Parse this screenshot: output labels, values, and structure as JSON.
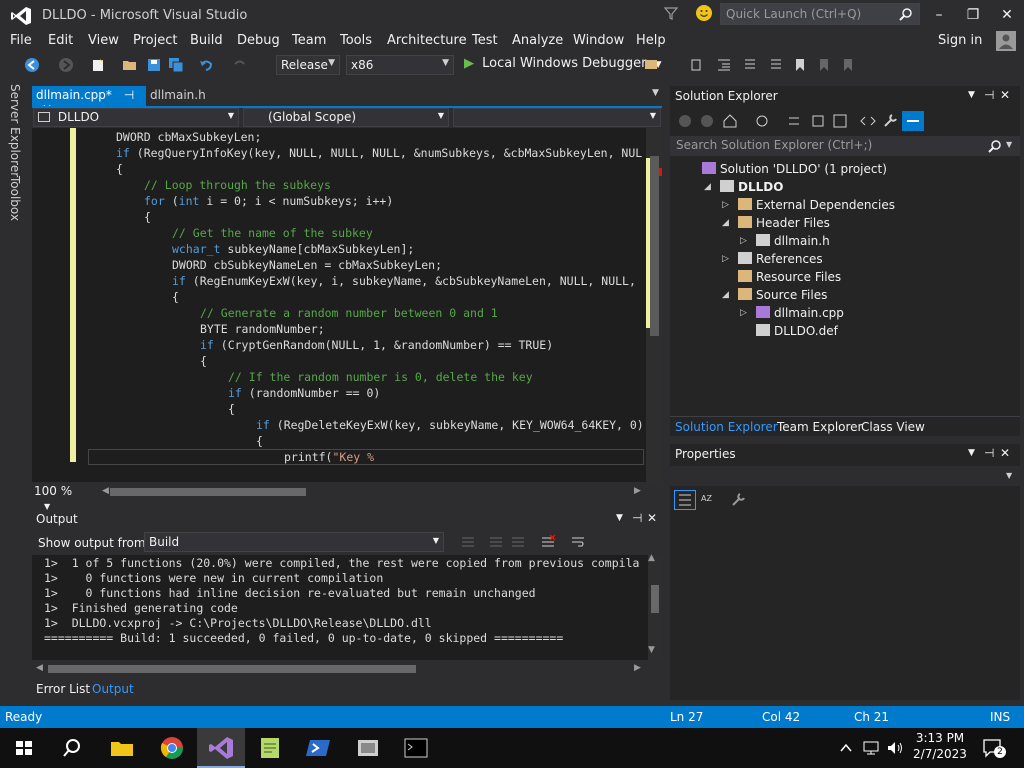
{
  "window": {
    "title": "DLLDO - Microsoft Visual Studio",
    "quick_launch_placeholder": "Quick Launch (Ctrl+Q)",
    "minimize": "–",
    "maximize": "❐",
    "close": "✕"
  },
  "menu": [
    "File",
    "Edit",
    "View",
    "Project",
    "Build",
    "Debug",
    "Team",
    "Tools",
    "Architecture",
    "Test",
    "Analyze",
    "Window",
    "Help"
  ],
  "account": {
    "sign_in": "Sign in"
  },
  "toolbar": {
    "configuration": "Release",
    "platform": "x86",
    "run_label": "Local Windows Debugger"
  },
  "left_strip": {
    "server_explorer": "Server Explorer",
    "toolbox": "Toolbox"
  },
  "editor": {
    "tabs": [
      {
        "label": "dllmain.cpp*",
        "pin": "⊣",
        "close": "✕"
      },
      {
        "label": "dllmain.h"
      }
    ],
    "nav_project": "DLLDO",
    "nav_scope": "(Global Scope)",
    "zoom": "100 %",
    "lines": [
      {
        "indent": 0,
        "parts": [
          {
            "t": "DWORD cbMaxSubkeyLen;",
            "c": ""
          }
        ]
      },
      {
        "indent": 0,
        "parts": [
          {
            "t": "if",
            "c": "kw"
          },
          {
            "t": " (RegQueryInfoKey(key, NULL, NULL, NULL, &numSubkeys, &cbMaxSubkeyLen, NUL",
            "c": ""
          }
        ]
      },
      {
        "indent": 0,
        "parts": [
          {
            "t": "{",
            "c": ""
          }
        ]
      },
      {
        "indent": 4,
        "parts": [
          {
            "t": "// Loop through the subkeys",
            "c": "cm"
          }
        ]
      },
      {
        "indent": 4,
        "parts": [
          {
            "t": "for",
            "c": "kw"
          },
          {
            "t": " (",
            "c": ""
          },
          {
            "t": "int",
            "c": "kw"
          },
          {
            "t": " i = 0; i < numSubkeys; i++)",
            "c": ""
          }
        ]
      },
      {
        "indent": 4,
        "parts": [
          {
            "t": "{",
            "c": ""
          }
        ]
      },
      {
        "indent": 8,
        "parts": [
          {
            "t": "// Get the name of the subkey",
            "c": "cm"
          }
        ]
      },
      {
        "indent": 8,
        "parts": [
          {
            "t": "wchar_t",
            "c": "kw"
          },
          {
            "t": " subkeyName[cbMaxSubkeyLen];",
            "c": ""
          }
        ]
      },
      {
        "indent": 8,
        "parts": [
          {
            "t": "DWORD cbSubkeyNameLen = cbMaxSubkeyLen;",
            "c": ""
          }
        ]
      },
      {
        "indent": 8,
        "parts": [
          {
            "t": "if",
            "c": "kw"
          },
          {
            "t": " (RegEnumKeyExW(key, i, subkeyName, &cbSubkeyNameLen, NULL, NULL,",
            "c": ""
          }
        ]
      },
      {
        "indent": 8,
        "parts": [
          {
            "t": "{",
            "c": ""
          }
        ]
      },
      {
        "indent": 12,
        "parts": [
          {
            "t": "// Generate a random number between 0 and 1",
            "c": "cm"
          }
        ]
      },
      {
        "indent": 12,
        "parts": [
          {
            "t": "BYTE randomNumber;",
            "c": ""
          }
        ]
      },
      {
        "indent": 12,
        "parts": [
          {
            "t": "if",
            "c": "kw"
          },
          {
            "t": " (CryptGenRandom(NULL, 1, &randomNumber) == TRUE)",
            "c": ""
          }
        ]
      },
      {
        "indent": 12,
        "parts": [
          {
            "t": "{",
            "c": ""
          }
        ]
      },
      {
        "indent": 16,
        "parts": [
          {
            "t": "// If the random number is 0, delete the key",
            "c": "cm"
          }
        ]
      },
      {
        "indent": 16,
        "parts": [
          {
            "t": "if",
            "c": "kw"
          },
          {
            "t": " (randomNumber == 0)",
            "c": ""
          }
        ]
      },
      {
        "indent": 16,
        "parts": [
          {
            "t": "{",
            "c": ""
          }
        ]
      },
      {
        "indent": 20,
        "parts": [
          {
            "t": "if",
            "c": "kw"
          },
          {
            "t": " (RegDeleteKeyExW(key, subkeyName, KEY_WOW64_64KEY, 0)",
            "c": ""
          }
        ]
      },
      {
        "indent": 20,
        "parts": [
          {
            "t": "{",
            "c": ""
          }
        ]
      },
      {
        "indent": 24,
        "parts": [
          {
            "t": "printf(",
            "c": ""
          },
          {
            "t": "\"Key %",
            "c": "str"
          }
        ]
      }
    ]
  },
  "output": {
    "title": "Output",
    "show_from_label": "Show output from:",
    "show_from_value": "Build",
    "lines": [
      "1>  1 of 5 functions (20.0%) were compiled, the rest were copied from previous compila",
      "1>    0 functions were new in current compilation",
      "1>    0 functions had inline decision re-evaluated but remain unchanged",
      "1>  Finished generating code",
      "1>  DLLDO.vcxproj -> C:\\Projects\\DLLDO\\Release\\DLLDO.dll",
      "========== Build: 1 succeeded, 0 failed, 0 up-to-date, 0 skipped =========="
    ],
    "tabs": [
      "Error List",
      "Output"
    ]
  },
  "solution_explorer": {
    "title": "Solution Explorer",
    "search_placeholder": "Search Solution Explorer (Ctrl+;)",
    "tree": [
      {
        "label": "Solution 'DLLDO' (1 project)",
        "icon": "solution-icon",
        "expander": ""
      },
      {
        "label": "DLLDO",
        "icon": "project-icon",
        "expander": "◢",
        "bold": true
      },
      {
        "label": "External Dependencies",
        "icon": "folder-icon",
        "expander": "▷"
      },
      {
        "label": "Header Files",
        "icon": "folder-icon",
        "expander": "◢"
      },
      {
        "label": "dllmain.h",
        "icon": "header-file-icon",
        "expander": "▷"
      },
      {
        "label": "References",
        "icon": "references-icon",
        "expander": "▷"
      },
      {
        "label": "Resource Files",
        "icon": "folder-icon",
        "expander": ""
      },
      {
        "label": "Source Files",
        "icon": "folder-icon",
        "expander": "◢"
      },
      {
        "label": "dllmain.cpp",
        "icon": "cpp-file-icon",
        "expander": "▷"
      },
      {
        "label": "DLLDO.def",
        "icon": "def-file-icon",
        "expander": ""
      }
    ],
    "bottom_tabs": [
      "Solution Explorer",
      "Team Explorer",
      "Class View"
    ]
  },
  "properties": {
    "title": "Properties"
  },
  "statusbar": {
    "ready": "Ready",
    "ln": "Ln 27",
    "col": "Col 42",
    "ch": "Ch 21",
    "ins": "INS"
  },
  "taskbar": {
    "time": "3:13 PM",
    "date": "2/7/2023",
    "notifications": "2"
  },
  "colors": {
    "accent": "#007acc",
    "keyword": "#569cd6",
    "comment": "#57a64a",
    "string": "#d69d85"
  }
}
